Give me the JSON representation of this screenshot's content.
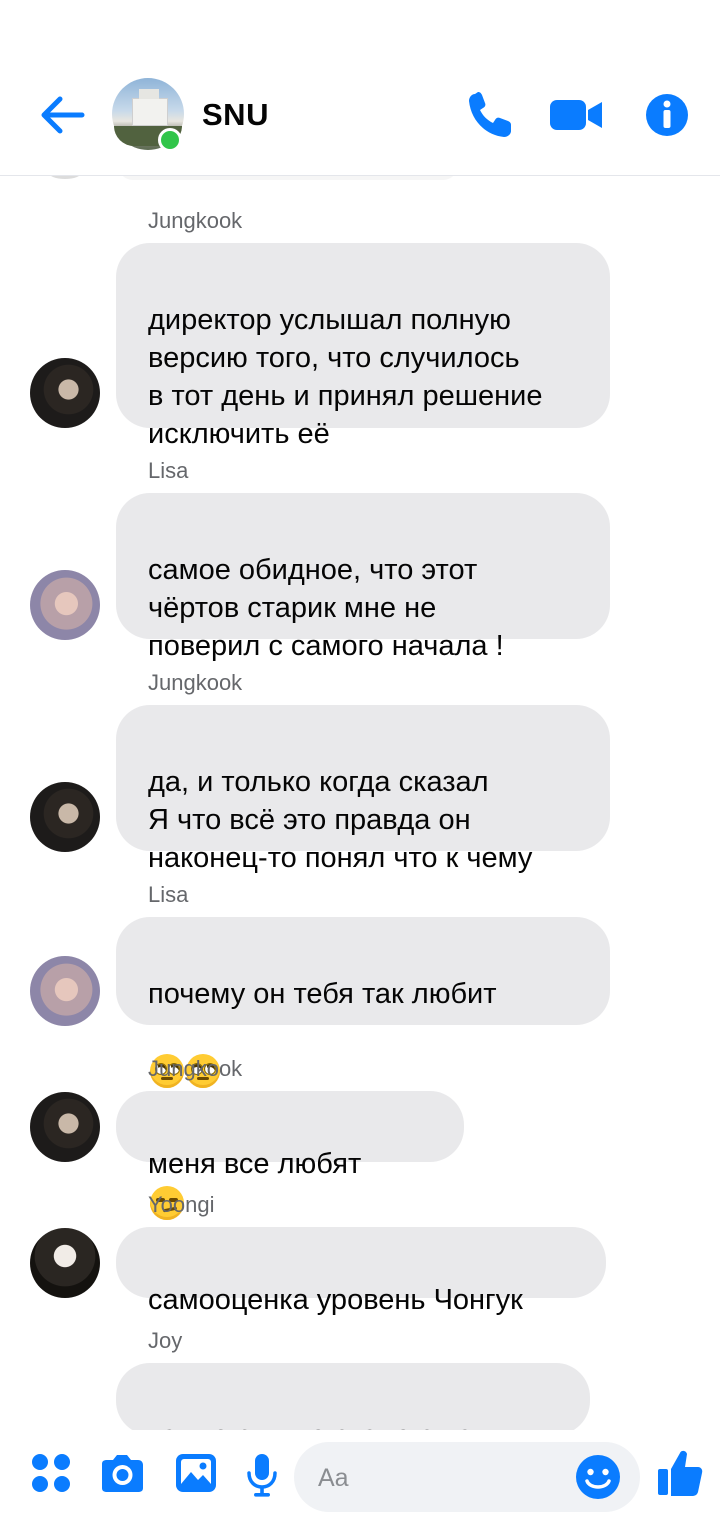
{
  "header": {
    "title": "SNU",
    "status": "online"
  },
  "messages": [
    {
      "sender": "Jungkook",
      "avatar": "jungkook-avatar",
      "text": "директор услышал полную\nверсию того, что случилось\nв тот день и принял решение\nисключить её"
    },
    {
      "sender": "Lisa",
      "avatar": "lisa-avatar",
      "text": "самое обидное, что этот\nчёртов старик мне не\nповерил с самого начала !"
    },
    {
      "sender": "Jungkook",
      "avatar": "jungkook-avatar",
      "text": "да, и только когда сказал\nЯ что всё это правда он\nнаконец-то понял что к чему"
    },
    {
      "sender": "Lisa",
      "avatar": "lisa-avatar",
      "text": "почему он тебя так любит",
      "emoji": "🙄🙄"
    },
    {
      "sender": "Jungkook",
      "avatar": "jungkook-avatar",
      "text": "меня все любят",
      "emoji": "😏"
    },
    {
      "sender": "Yoongi",
      "avatar": "yoongi-avatar",
      "text": "самооценка уровень Чонгук"
    },
    {
      "sender": "Joy",
      "text": "как-то скучно стало с вами"
    }
  ],
  "composer": {
    "placeholder": "Aa"
  },
  "colors": {
    "accent": "#0a7cff",
    "bubble": "#e9e9eb",
    "online": "#31c54a",
    "sender": "#65676b"
  },
  "icons": [
    "back-arrow-icon",
    "phone-icon",
    "video-camera-icon",
    "info-icon",
    "apps-icon",
    "camera-icon",
    "gallery-icon",
    "microphone-icon",
    "emoji-icon",
    "thumbs-up-icon"
  ]
}
